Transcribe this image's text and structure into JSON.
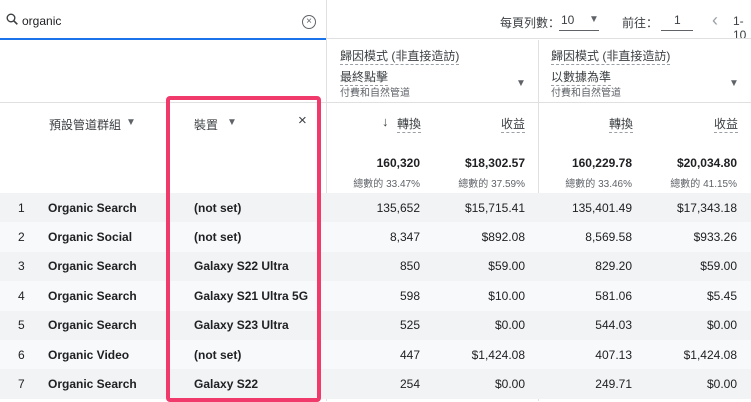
{
  "search": {
    "value": "organic"
  },
  "pager": {
    "rows_label": "每頁列數：",
    "rows_value": "10",
    "goto_label": "前往：",
    "goto_value": "1",
    "range": "1-10"
  },
  "attribution": [
    {
      "title": "歸因模式 (非直接造訪)",
      "model": "最終點擊",
      "sub": "付費和自然管道"
    },
    {
      "title": "歸因模式 (非直接造訪)",
      "model": "以數據為準",
      "sub": "付費和自然管道"
    }
  ],
  "columns": {
    "channel": "預設管道群組",
    "device": "裝置",
    "conv1": "轉換",
    "rev1": "收益",
    "conv2": "轉換",
    "rev2": "收益"
  },
  "totals": {
    "conv1": "160,320",
    "conv1_pct": "總數的 33.47%",
    "rev1": "$18,302.57",
    "rev1_pct": "總數的 37.59%",
    "conv2": "160,229.78",
    "conv2_pct": "總數的 33.46%",
    "rev2": "$20,034.80",
    "rev2_pct": "總數的 41.15%"
  },
  "rows": [
    {
      "idx": "1",
      "channel": "Organic Search",
      "device": "(not set)",
      "conv1": "135,652",
      "rev1": "$15,715.41",
      "conv2": "135,401.49",
      "rev2": "$17,343.18"
    },
    {
      "idx": "2",
      "channel": "Organic Social",
      "device": "(not set)",
      "conv1": "8,347",
      "rev1": "$892.08",
      "conv2": "8,569.58",
      "rev2": "$933.26"
    },
    {
      "idx": "3",
      "channel": "Organic Search",
      "device": "Galaxy S22 Ultra",
      "conv1": "850",
      "rev1": "$59.00",
      "conv2": "829.20",
      "rev2": "$59.00"
    },
    {
      "idx": "4",
      "channel": "Organic Search",
      "device": "Galaxy S21 Ultra 5G",
      "conv1": "598",
      "rev1": "$10.00",
      "conv2": "581.06",
      "rev2": "$5.45"
    },
    {
      "idx": "5",
      "channel": "Organic Search",
      "device": "Galaxy S23 Ultra",
      "conv1": "525",
      "rev1": "$0.00",
      "conv2": "544.03",
      "rev2": "$0.00"
    },
    {
      "idx": "6",
      "channel": "Organic Video",
      "device": "(not set)",
      "conv1": "447",
      "rev1": "$1,424.08",
      "conv2": "407.13",
      "rev2": "$1,424.08"
    },
    {
      "idx": "7",
      "channel": "Organic Search",
      "device": "Galaxy S22",
      "conv1": "254",
      "rev1": "$0.00",
      "conv2": "249.71",
      "rev2": "$0.00"
    }
  ]
}
